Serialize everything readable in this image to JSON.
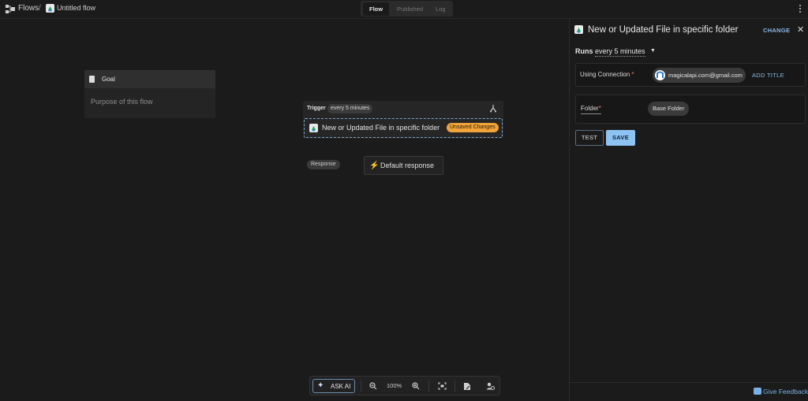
{
  "topbar": {
    "breadcrumb_root": "Flows",
    "breadcrumb_sep": "/",
    "flow_title": "Untitled flow",
    "tabs": [
      "Flow",
      "Published",
      "Log"
    ],
    "active_tab": "Flow"
  },
  "goal": {
    "label": "Goal",
    "placeholder": "Purpose of this flow"
  },
  "trigger": {
    "label": "Trigger",
    "schedule_chip": "every 5 minutes",
    "step_name": "New or Updated File in specific folder",
    "status_badge": "Unsaved Changes"
  },
  "response": {
    "chip": "Response",
    "default_label": "Default response"
  },
  "toolbar": {
    "ask_ai": "ASK AI",
    "zoom": "100%"
  },
  "panel": {
    "title": "New or Updated File in specific folder",
    "change": "CHANGE",
    "runs_label": "Runs",
    "runs_value": "every 5 minutes",
    "connection_label": "Using Connection",
    "connection_required": "*",
    "connection_email": "magicalapi.com@gmail.com",
    "add_title": "ADD TITLE",
    "folder_label": "Folder",
    "folder_required": "*",
    "folder_value": "Base Folder",
    "test_button": "TEST",
    "save_button": "SAVE",
    "feedback": "Give Feedback"
  },
  "colors": {
    "background": "#1b1b1b",
    "accent": "#8ec2f2",
    "unsaved": "#f0a43a",
    "link": "#8ab8e6"
  },
  "icons": [
    "flows-icon",
    "google-drive-icon",
    "kebab-menu-icon",
    "document-icon",
    "fork-icon",
    "bolt-icon",
    "sparkle-icon",
    "zoom-out-icon",
    "zoom-in-icon",
    "fit-view-icon",
    "notes-icon",
    "add-user-icon",
    "close-icon",
    "chevron-down-icon",
    "avatar-icon",
    "feedback-icon"
  ]
}
